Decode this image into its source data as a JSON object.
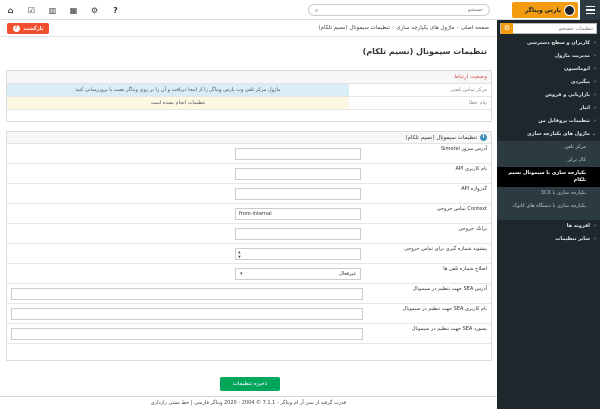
{
  "header": {
    "logo_text": "پارس ویناگر",
    "search_placeholder": "جستجو",
    "icons": [
      "help-icon",
      "gear-icon",
      "calendar-icon",
      "chart-icon",
      "checklist-icon",
      "home-icon"
    ]
  },
  "sidebar": {
    "search_placeholder": "تنظیمات جستجو",
    "items": [
      {
        "label": "کاربران و سطح دسترسی",
        "chevron": "‹"
      },
      {
        "label": "مدیریت ماژول",
        "chevron": "‹"
      },
      {
        "label": "اتوماسیون",
        "chevron": "‹"
      },
      {
        "label": "پیگیردی",
        "chevron": "‹"
      },
      {
        "label": "بازاریابی و فروش",
        "chevron": "‹"
      },
      {
        "label": "انبار",
        "chevron": "‹"
      },
      {
        "label": "تنظیمات پروفایل من",
        "chevron": "‹"
      },
      {
        "label": "ماژول های یکپارچه سازی",
        "chevron": "⌄"
      }
    ],
    "subitems": [
      {
        "label": "مرکز تلفن"
      },
      {
        "label": "کال ترکر"
      },
      {
        "label": "یکپارچه سازی با سیمونال نسیم تلکام"
      },
      {
        "label": "یکپارچه سازی با 3CX"
      },
      {
        "label": "یکپارچه سازی با دستگاه های کانوک"
      }
    ],
    "tail_items": [
      {
        "label": "افزونه ها",
        "chevron": "‹"
      },
      {
        "label": "سایر تنظیمات",
        "chevron": "‹"
      }
    ]
  },
  "breadcrumb": {
    "home": "صفحه اصلی",
    "parent": "ماژول های یکپارچه سازی",
    "current": "تنظیمات سیمونال (نسیم تلکام)",
    "sep": "›"
  },
  "back_button": {
    "label": "بازگشت",
    "help": "?"
  },
  "page_title": "تنظیمات سیمونال (نسیم تلکام)",
  "status": {
    "heading": "وضعیت ارتباط",
    "rows": [
      {
        "label": "مرکز تماس تلفنی",
        "value": "ماژول مرکز تلفن وب پارس ویناگر را از اینجا دریافت و آن را بر روی ویناگر نصب یا بروزرسانی کنید"
      },
      {
        "label": "پیام خطا",
        "value": "تنظیمات انجام نشده است"
      }
    ]
  },
  "settings": {
    "heading": "تنظیمات سیمونال (نسیم تلکام)",
    "info_icon": "i",
    "fields": [
      {
        "label": "آدرس سرور Simotel",
        "value": ""
      },
      {
        "label": "نام کاربری API",
        "value": ""
      },
      {
        "label": "گذرواژه API",
        "value": ""
      },
      {
        "label": "Context تماس خروجی",
        "value": "from-internal"
      },
      {
        "label": "ترانک خروجی",
        "value": ""
      }
    ],
    "spinner": {
      "label": "پیشوند شماره گیری برای تماس خروجی",
      "up": "▲",
      "down": "▼"
    },
    "select": {
      "label": "اصلاح شماره تلفن ها",
      "value": "غیرفعال",
      "caret": "▾"
    },
    "wide_fields": [
      {
        "label": "آدرس SEA جهت تنظیم در سیمونال",
        "value": ""
      },
      {
        "label": "نام کاربری SEA جهت تنظیم در سیمونال",
        "value": ""
      },
      {
        "label": "پسورد SEA جهت تنظیم در سیمونال",
        "value": ""
      }
    ]
  },
  "save_button": "ذخیره تنظیمات",
  "footer": "قدرت گرفته از سی آر ام ویناگر - 7.1.1 © 2004 - 2020 ویناگر فارسی | خط مشی رازداری"
}
